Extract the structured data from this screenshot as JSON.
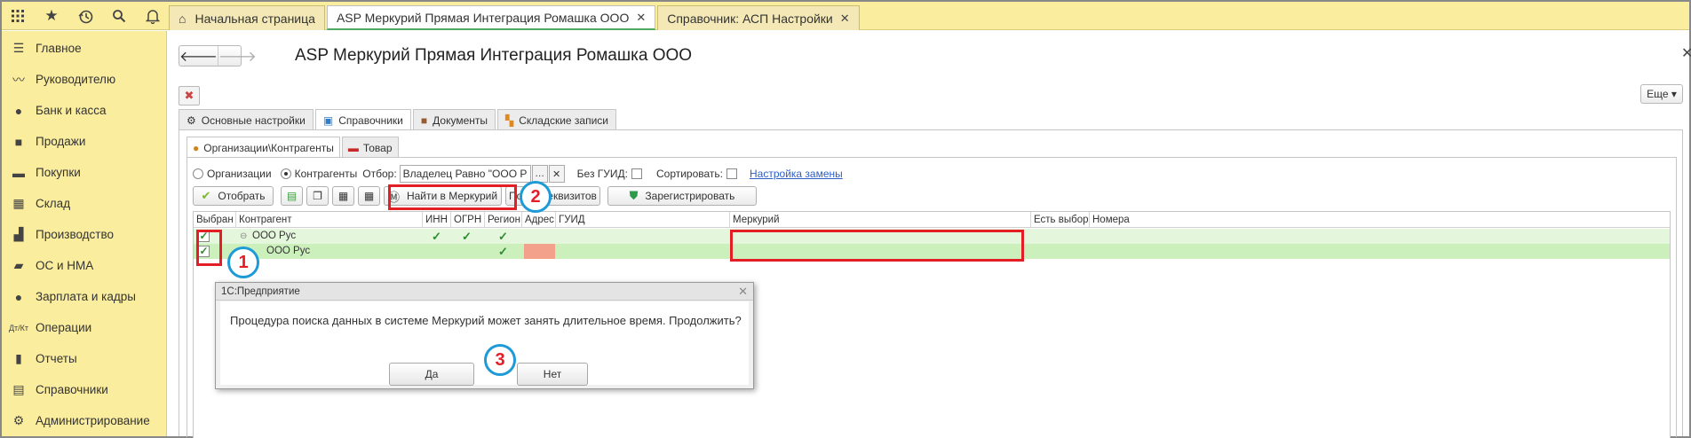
{
  "topbar": {
    "icons": [
      "apps-grid-icon",
      "star-icon",
      "history-icon",
      "search-icon",
      "bell-icon"
    ],
    "tabs": [
      {
        "label": "Начальная страница",
        "closable": false
      },
      {
        "label": "ASP Меркурий Прямая Интеграция Ромашка ООО",
        "closable": true
      },
      {
        "label": "Справочник: АСП Настройки",
        "closable": true
      }
    ]
  },
  "sidebar": {
    "items": [
      {
        "label": "Главное",
        "icon": "menu-lines-icon"
      },
      {
        "label": "Руководителю",
        "icon": "trend-icon"
      },
      {
        "label": "Банк и касса",
        "icon": "ruble-coin-icon"
      },
      {
        "label": "Продажи",
        "icon": "shopping-bag-icon"
      },
      {
        "label": "Покупки",
        "icon": "cart-icon"
      },
      {
        "label": "Склад",
        "icon": "warehouse-grid-icon"
      },
      {
        "label": "Производство",
        "icon": "factory-icon"
      },
      {
        "label": "ОС и НМА",
        "icon": "truck-icon"
      },
      {
        "label": "Зарплата и кадры",
        "icon": "person-icon"
      },
      {
        "label": "Операции",
        "icon": "dt-kt-icon"
      },
      {
        "label": "Отчеты",
        "icon": "bar-chart-icon"
      },
      {
        "label": "Справочники",
        "icon": "books-icon"
      },
      {
        "label": "Администрирование",
        "icon": "gear-icon"
      }
    ]
  },
  "window": {
    "title": "ASP Меркурий Прямая Интеграция Ромашка ООО",
    "more_label": "Еще ▾",
    "form_tabs": [
      "Основные настройки",
      "Справочники",
      "Документы",
      "Складские записи"
    ],
    "sub_tabs": [
      "Организации\\Контрагенты",
      "Товар"
    ]
  },
  "filter": {
    "radio_org": "Организации",
    "radio_contr": "Контрагенты",
    "selection_label": "Отбор:",
    "selection_value": "Владелец Равно \"ООО Р",
    "no_guid_label": "Без ГУИД:",
    "sort_label": "Сортировать:",
    "replace_link": "Настройка замены"
  },
  "buttons": {
    "select": "Отобрать",
    "find_mercury": "Найти в Меркурий",
    "find_details": "Поиск реквизитов",
    "register": "Зарегистрировать"
  },
  "table": {
    "columns": [
      "Выбран",
      "Контрагент",
      "ИНН",
      "ОГРН",
      "Регион",
      "Адрес",
      "ГУИД",
      "Меркурий",
      "Есть выбор",
      "Номера"
    ],
    "rows": [
      {
        "selected": true,
        "name": "ООО Рус",
        "group": true,
        "inn": true,
        "ogrn": true,
        "region": true
      },
      {
        "selected": true,
        "name": "ООО Рус",
        "group": false,
        "inn": false,
        "ogrn": false,
        "region": true,
        "address_flag": true
      }
    ],
    "colors": {
      "row": "#e4f6dc",
      "row_selected": "#ccf0bc",
      "address_warning": "#f4a18c"
    }
  },
  "dialog": {
    "title": "1С:Предприятие",
    "message": "Процедура поиска данных в системе Меркурий может занять длительное время. Продолжить?",
    "yes": "Да",
    "no": "Нет"
  },
  "annotations": {
    "markers": [
      "1",
      "2",
      "3"
    ],
    "color_box": "#e41e25",
    "color_circle": "#1e9bd7"
  },
  "colors": {
    "accent_yellow": "#fbed9e",
    "active_tab_line": "#4fa85f",
    "link": "#2c5ec4"
  }
}
